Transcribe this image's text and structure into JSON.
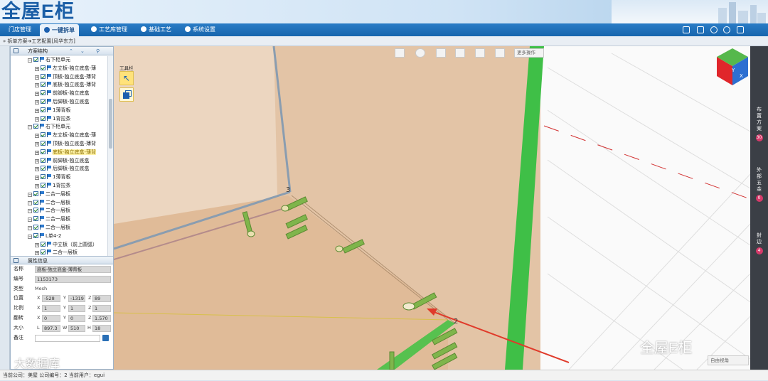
{
  "app": {
    "logo": "全屋E柜"
  },
  "menu": {
    "items": [
      {
        "label": "门店管理"
      },
      {
        "label": "一键拆单"
      },
      {
        "label": "工艺库管理"
      },
      {
        "label": "基础工艺"
      },
      {
        "label": "系统设置"
      }
    ]
  },
  "breadcrumb": "拆单方案➔工艺配置[风华东方]",
  "tree": {
    "title": "方案结构",
    "rows": [
      {
        "label": "右下柜单元",
        "level": 0
      },
      {
        "label": "左立板-独立底盒-薄",
        "level": 1
      },
      {
        "label": "顶板-独立底盒-薄背",
        "level": 1
      },
      {
        "label": "底板-独立底盒-薄背",
        "level": 1
      },
      {
        "label": "前脚板-独立底盒",
        "level": 1
      },
      {
        "label": "后脚板-独立底盒",
        "level": 1
      },
      {
        "label": "1薄背板",
        "level": 1
      },
      {
        "label": "1背拉条",
        "level": 1
      },
      {
        "label": "右下柜单元",
        "level": 0
      },
      {
        "label": "左立板-独立底盒-薄",
        "level": 1
      },
      {
        "label": "顶板-独立底盒-薄背",
        "level": 1
      },
      {
        "label": "底板-独立底盒-薄背",
        "level": 1,
        "selected": true
      },
      {
        "label": "前脚板-独立底盒",
        "level": 1
      },
      {
        "label": "后脚板-独立底盒",
        "level": 1
      },
      {
        "label": "1薄背板",
        "level": 1
      },
      {
        "label": "1背拉条",
        "level": 1
      },
      {
        "label": "二合一层板",
        "level": 0
      },
      {
        "label": "二合一层板",
        "level": 0
      },
      {
        "label": "二合一层板",
        "level": 0
      },
      {
        "label": "二合一层板",
        "level": 0
      },
      {
        "label": "二合一层板",
        "level": 0
      },
      {
        "label": "L单4-2",
        "level": 0
      },
      {
        "label": "中立板（前上圆弧）",
        "level": 1
      },
      {
        "label": "二合一层板",
        "level": 1
      }
    ]
  },
  "props": {
    "title": "属性信息",
    "name_label": "名称",
    "name_value": "底板-独立底盒-薄背板",
    "code_label": "编号",
    "code_value": "1153173",
    "type_label": "类型",
    "type_value": "Mesh",
    "pos_label": "位置",
    "pos_x": "-528",
    "pos_y": "-1319",
    "pos_z": "89",
    "scale_label": "比例",
    "scale_x": "1",
    "scale_y": "1",
    "scale_z": "1",
    "rot_label": "翻转",
    "rot_x": "0",
    "rot_y": "0",
    "rot_z": "1.570",
    "size_label": "大小",
    "size_l": "897.3",
    "size_w": "510",
    "size_h": "18",
    "note_label": "备注",
    "axis_x": "X",
    "axis_y": "Y",
    "axis_z": "Z",
    "axis_l": "L",
    "axis_w": "W",
    "axis_h": "H"
  },
  "viewport": {
    "more_ops": "更多操作",
    "toolbox": "工具栏",
    "label_3": "3",
    "label_2": "2",
    "view_select": "自由视角",
    "cube_labels": [
      "Y",
      "X"
    ]
  },
  "rightbar": {
    "items": [
      {
        "label": "布置方案",
        "badge": "30"
      },
      {
        "label": "外部五金",
        "badge": "0"
      },
      {
        "label": "封边",
        "badge": "4"
      }
    ]
  },
  "status": "当前公司：美屋   公司编号：2   当前用户：egui",
  "watermarks": {
    "left": "大数据库",
    "right": "全屋E柜"
  }
}
